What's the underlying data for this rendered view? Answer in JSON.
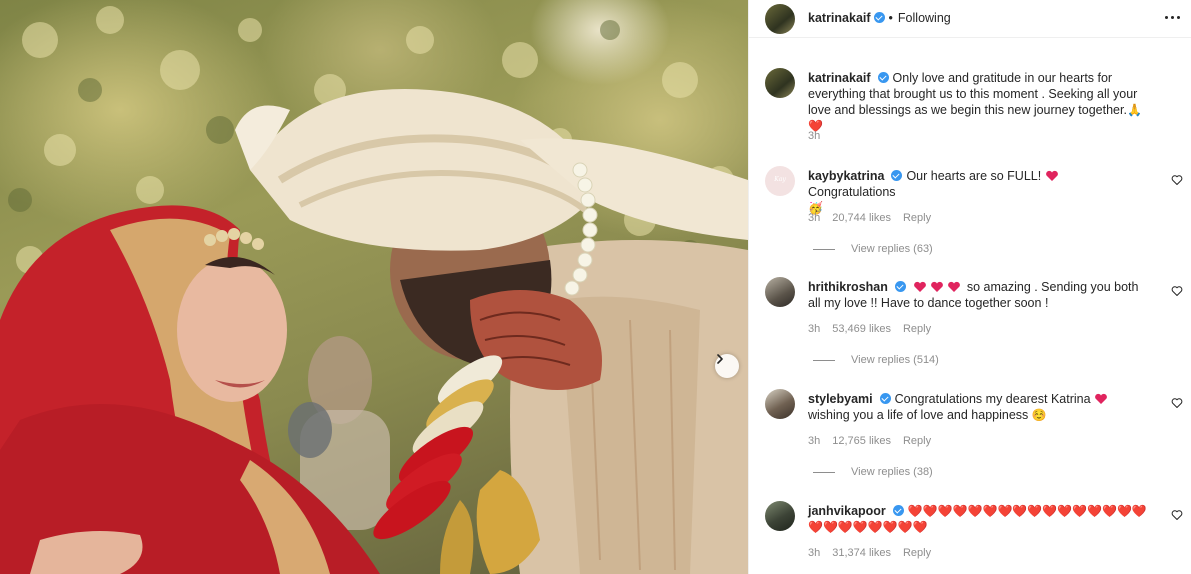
{
  "post": {
    "username": "katrinakaif",
    "follow_status": "Following",
    "separator": "•",
    "colors": {
      "verified": "#3897f0",
      "text": "#262626",
      "muted": "#8e8e8e",
      "heart": "#e0245e"
    }
  },
  "caption": {
    "username": "katrinakaif",
    "text": "Only love and gratitude in our hearts for everything that brought us to this moment . Seeking all your love and blessings as we begin this new journey together.",
    "emoji": "🙏❤️",
    "time": "3h"
  },
  "comments": [
    {
      "username": "kaybykatrina",
      "avatar_text": "Kay",
      "text": "Our hearts are so FULL!",
      "text_after": "Congratulations",
      "emoji_tail": "🥳",
      "time": "3h",
      "likes": "20,744 likes",
      "reply": "Reply",
      "view_replies": "View replies (63)"
    },
    {
      "username": "hrithikroshan",
      "text": "so amazing . Sending you both all my love !! Have to dance together soon !",
      "time": "3h",
      "likes": "53,469 likes",
      "reply": "Reply",
      "view_replies": "View replies (514)"
    },
    {
      "username": "stylebyami",
      "text": "Congratulations my dearest Katrina",
      "text_after": "wishing you a life of love and happiness",
      "emoji_tail": "☺️",
      "time": "3h",
      "likes": "12,765 likes",
      "reply": "Reply",
      "view_replies": "View replies (38)"
    },
    {
      "username": "janhvikapoor",
      "text": "❤️❤️❤️❤️❤️❤️❤️❤️❤️❤️❤️❤️❤️❤️❤️❤️❤️❤️❤️❤️❤️❤️❤️❤️",
      "time": "3h",
      "likes": "31,374 likes",
      "reply": "Reply"
    }
  ],
  "icons": [
    "more-options-icon",
    "verified-badge-icon",
    "like-heart-icon",
    "carousel-next-icon"
  ]
}
